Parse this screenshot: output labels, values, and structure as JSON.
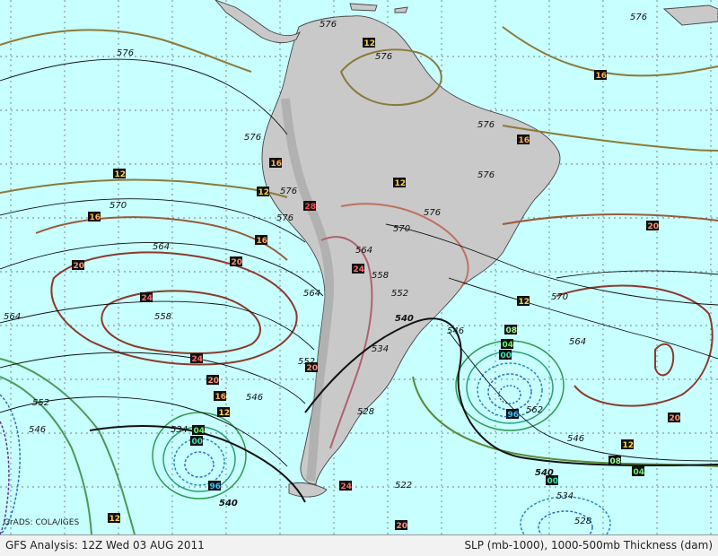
{
  "credit": "GrADS: COLA/IGES",
  "footer": {
    "left": "GFS Analysis: 12Z Wed 03 AUG 2011",
    "right": "SLP (mb-1000), 1000-500mb Thickness (dam)"
  },
  "colors": {
    "ocean": "#c8ffff",
    "land": "#c9c9c9",
    "high_pressure": "#8b3a2b",
    "low_pressure": "#1f8a6a",
    "thickness": "#111111"
  },
  "thickness_labels": [
    "576",
    "576",
    "576",
    "576",
    "576",
    "576",
    "576",
    "576",
    "576",
    "576",
    "570",
    "570",
    "570",
    "564",
    "564",
    "564",
    "564",
    "564",
    "558",
    "558",
    "552",
    "552",
    "552",
    "546",
    "546",
    "546",
    "546",
    "540",
    "540",
    "540",
    "534",
    "534",
    "534",
    "528",
    "528",
    "522",
    "562"
  ],
  "pressure_labels": [
    {
      "t": "12",
      "bg": "#101010",
      "fg": "#ffd34a"
    },
    {
      "t": "12",
      "bg": "#101010",
      "fg": "#ffd34a"
    },
    {
      "t": "12",
      "bg": "#101010",
      "fg": "#ffd34a"
    },
    {
      "t": "12",
      "bg": "#101010",
      "fg": "#ffd34a"
    },
    {
      "t": "12",
      "bg": "#101010",
      "fg": "#ffd34a"
    },
    {
      "t": "12",
      "bg": "#101010",
      "fg": "#ffd34a"
    },
    {
      "t": "12",
      "bg": "#101010",
      "fg": "#ffd34a"
    },
    {
      "t": "12",
      "bg": "#101010",
      "fg": "#ffd34a"
    },
    {
      "t": "16",
      "bg": "#101010",
      "fg": "#ffb050"
    },
    {
      "t": "16",
      "bg": "#101010",
      "fg": "#ffb050"
    },
    {
      "t": "16",
      "bg": "#101010",
      "fg": "#ffb050"
    },
    {
      "t": "16",
      "bg": "#101010",
      "fg": "#ffb050"
    },
    {
      "t": "16",
      "bg": "#101010",
      "fg": "#ffb050"
    },
    {
      "t": "16",
      "bg": "#101010",
      "fg": "#ffb050"
    },
    {
      "t": "20",
      "bg": "#101010",
      "fg": "#ff9070"
    },
    {
      "t": "20",
      "bg": "#101010",
      "fg": "#ff9070"
    },
    {
      "t": "20",
      "bg": "#101010",
      "fg": "#ff9070"
    },
    {
      "t": "20",
      "bg": "#101010",
      "fg": "#ff9070"
    },
    {
      "t": "20",
      "bg": "#101010",
      "fg": "#ff9070"
    },
    {
      "t": "20",
      "bg": "#101010",
      "fg": "#ff9070"
    },
    {
      "t": "20",
      "bg": "#101010",
      "fg": "#ff9070"
    },
    {
      "t": "24",
      "bg": "#101010",
      "fg": "#ff6a6a"
    },
    {
      "t": "24",
      "bg": "#101010",
      "fg": "#ff6a6a"
    },
    {
      "t": "24",
      "bg": "#101010",
      "fg": "#ff6a6a"
    },
    {
      "t": "24",
      "bg": "#101010",
      "fg": "#ff6a6a"
    },
    {
      "t": "28",
      "bg": "#101010",
      "fg": "#ff4a4a"
    },
    {
      "t": "08",
      "bg": "#101010",
      "fg": "#9dff9d"
    },
    {
      "t": "08",
      "bg": "#101010",
      "fg": "#9dff9d"
    },
    {
      "t": "04",
      "bg": "#101010",
      "fg": "#6ef06e"
    },
    {
      "t": "04",
      "bg": "#101010",
      "fg": "#6ef06e"
    },
    {
      "t": "04",
      "bg": "#101010",
      "fg": "#6ef06e"
    },
    {
      "t": "00",
      "bg": "#101010",
      "fg": "#40e0b0"
    },
    {
      "t": "00",
      "bg": "#101010",
      "fg": "#40e0b0"
    },
    {
      "t": "00",
      "bg": "#101010",
      "fg": "#40e0b0"
    },
    {
      "t": "96",
      "bg": "#101010",
      "fg": "#40c0ff"
    },
    {
      "t": "96",
      "bg": "#101010",
      "fg": "#40c0ff"
    }
  ]
}
